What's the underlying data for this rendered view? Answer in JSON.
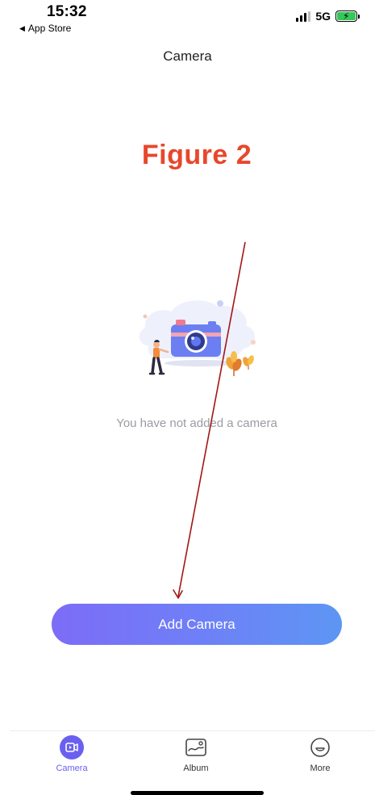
{
  "status_bar": {
    "time": "15:32",
    "back_app": "App Store",
    "network": "5G",
    "battery_fraction": 0.9
  },
  "nav": {
    "title": "Camera"
  },
  "figure_label": "Figure 2",
  "empty_state": {
    "message": "You have not added a camera"
  },
  "primary_action": {
    "label": "Add Camera"
  },
  "tabbar": {
    "items": [
      {
        "label": "Camera",
        "icon": "camera-tab-icon",
        "active": true
      },
      {
        "label": "Album",
        "icon": "album-tab-icon",
        "active": false
      },
      {
        "label": "More",
        "icon": "more-tab-icon",
        "active": false
      }
    ]
  },
  "colors": {
    "accent": "#6a60f0",
    "button_gradient_start": "#7c6cf7",
    "button_gradient_end": "#5d96f3",
    "figure_label": "#e8472c",
    "annotation_arrow": "#a31515",
    "empty_text": "#9a9ca3"
  }
}
